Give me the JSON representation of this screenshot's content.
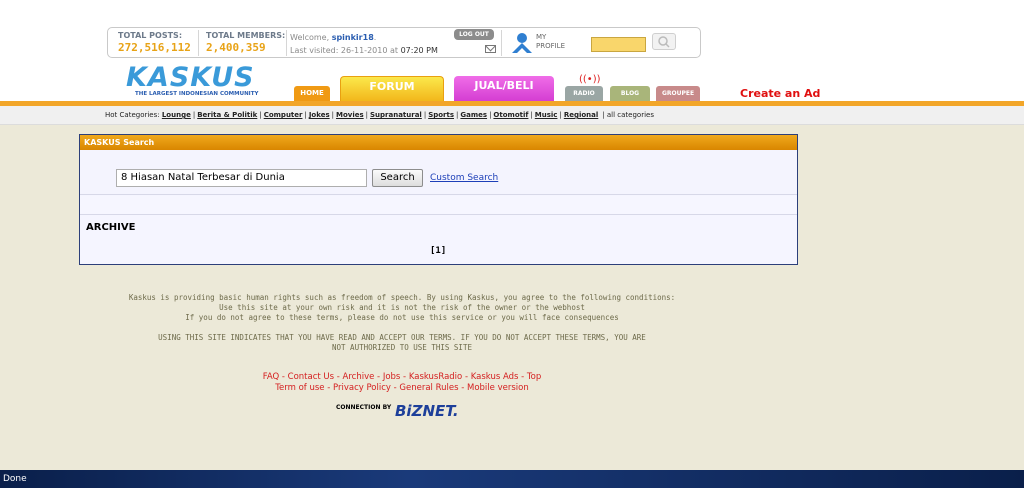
{
  "stats": {
    "total_posts_label": "TOTAL POSTS:",
    "total_posts_value": "272,516,112",
    "total_members_label": "TOTAL MEMBERS:",
    "total_members_value": "2,400,359"
  },
  "user": {
    "welcome_prefix": "Welcome,",
    "username": "spinkir18",
    "last_visited_prefix": "Last visited: 26-11-2010 at",
    "last_visited_time": "07:20 PM",
    "logout_label": "LOG OUT",
    "profile_label_1": "MY",
    "profile_label_2": "PROFILE"
  },
  "logo": {
    "text": "KASKUS",
    "tagline": "THE LARGEST INDONESIAN COMMUNITY"
  },
  "tabs": {
    "home": "HOME",
    "forum": "FORUM",
    "jual_beli": "JUAL/BELI",
    "radio": "RADIO",
    "blog": "BLOG",
    "groupee": "GROUPEE"
  },
  "create_ad": "Create an Ad",
  "hot_categories": {
    "label": "Hot Categories:",
    "items": [
      "Lounge",
      "Berita & Politik",
      "Computer",
      "Jokes",
      "Movies",
      "Supranatural",
      "Sports",
      "Games",
      "Otomotif",
      "Music",
      "Regional"
    ],
    "all": "all categories"
  },
  "search_panel": {
    "title": "KASKUS Search",
    "query": "8 Hiasan Natal Terbesar di Dunia",
    "button": "Search",
    "custom": "Custom Search",
    "archive": "ARCHIVE",
    "pager": "[1]"
  },
  "terms": {
    "line1": "Kaskus is providing basic human rights such as freedom of speech. By using Kaskus, you agree to the following conditions:",
    "line2": "Use this site at your own risk and it is not the risk of the owner or the webhost",
    "line3": "If you do not agree to these terms, please do not use this service or you will face consequences",
    "line4": "USING THIS SITE INDICATES THAT YOU HAVE READ AND ACCEPT OUR TERMS. IF YOU DO NOT ACCEPT THESE TERMS, YOU ARE",
    "line5": "NOT AUTHORIZED TO USE THIS SITE"
  },
  "footer": {
    "line1": "FAQ - Contact Us - Archive - Jobs - KaskusRadio - Kaskus Ads - Top",
    "line2": "Term of use - Privacy Policy - General Rules - Mobile version",
    "connection": "CONNECTION BY",
    "biznet": "BiZNET."
  },
  "status": "Done"
}
